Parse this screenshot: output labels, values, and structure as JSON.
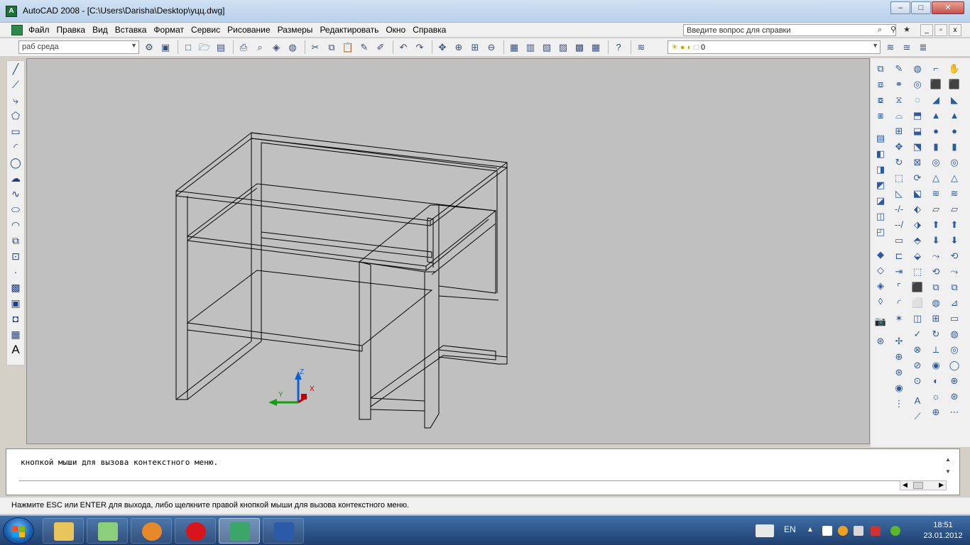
{
  "window": {
    "title": "AutoCAD 2008 - [C:\\Users\\Darisha\\Desktop\\уцц.dwg]",
    "app_icon_letter": "A",
    "minimize": "–",
    "maximize": "□",
    "close": "✕"
  },
  "menu": {
    "items": [
      "Файл",
      "Правка",
      "Вид",
      "Вставка",
      "Формат",
      "Сервис",
      "Рисование",
      "Размеры",
      "Редактировать",
      "Окно",
      "Справка"
    ],
    "help_placeholder": "Введите вопрос для справки",
    "mdi_minimize": "_",
    "mdi_restore": "▫",
    "mdi_close": "x"
  },
  "toolbar": {
    "workspace": "раб среда",
    "layer_value": "0"
  },
  "command": {
    "history_line": "кнопкой мыши для вызова контекстного меню."
  },
  "status": {
    "message": "Нажмите ESC или ENTER для выхода, либо щелкните правой кнопкой мыши для вызова контекстного меню."
  },
  "ucs": {
    "x_label": "X",
    "y_label": "Y",
    "z_label": "Z"
  },
  "taskbar": {
    "language": "EN",
    "time": "18:51",
    "date": "23.01.2012"
  },
  "colors": {
    "model_background": "#c0c0c0",
    "wireframe": "#000000",
    "ucs_x": "#c00000",
    "ucs_y": "#10a010",
    "ucs_z": "#1060d0"
  }
}
